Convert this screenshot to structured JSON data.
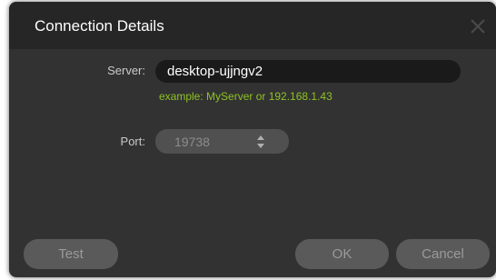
{
  "dialog": {
    "title": "Connection Details"
  },
  "server": {
    "label": "Server:",
    "value": "desktop-ujjngv2",
    "hint": "example: MyServer or 192.168.1.43"
  },
  "port": {
    "label": "Port:",
    "value": "19738"
  },
  "buttons": {
    "test": "Test",
    "ok": "OK",
    "cancel": "Cancel"
  },
  "colors": {
    "hint": "#8ec322",
    "dialog_bg": "#323232",
    "titlebar_bg": "#262626",
    "button_bg": "#5a5a5a"
  },
  "icons": {
    "close": "close-icon",
    "spinner": "spinner-arrows-icon"
  }
}
